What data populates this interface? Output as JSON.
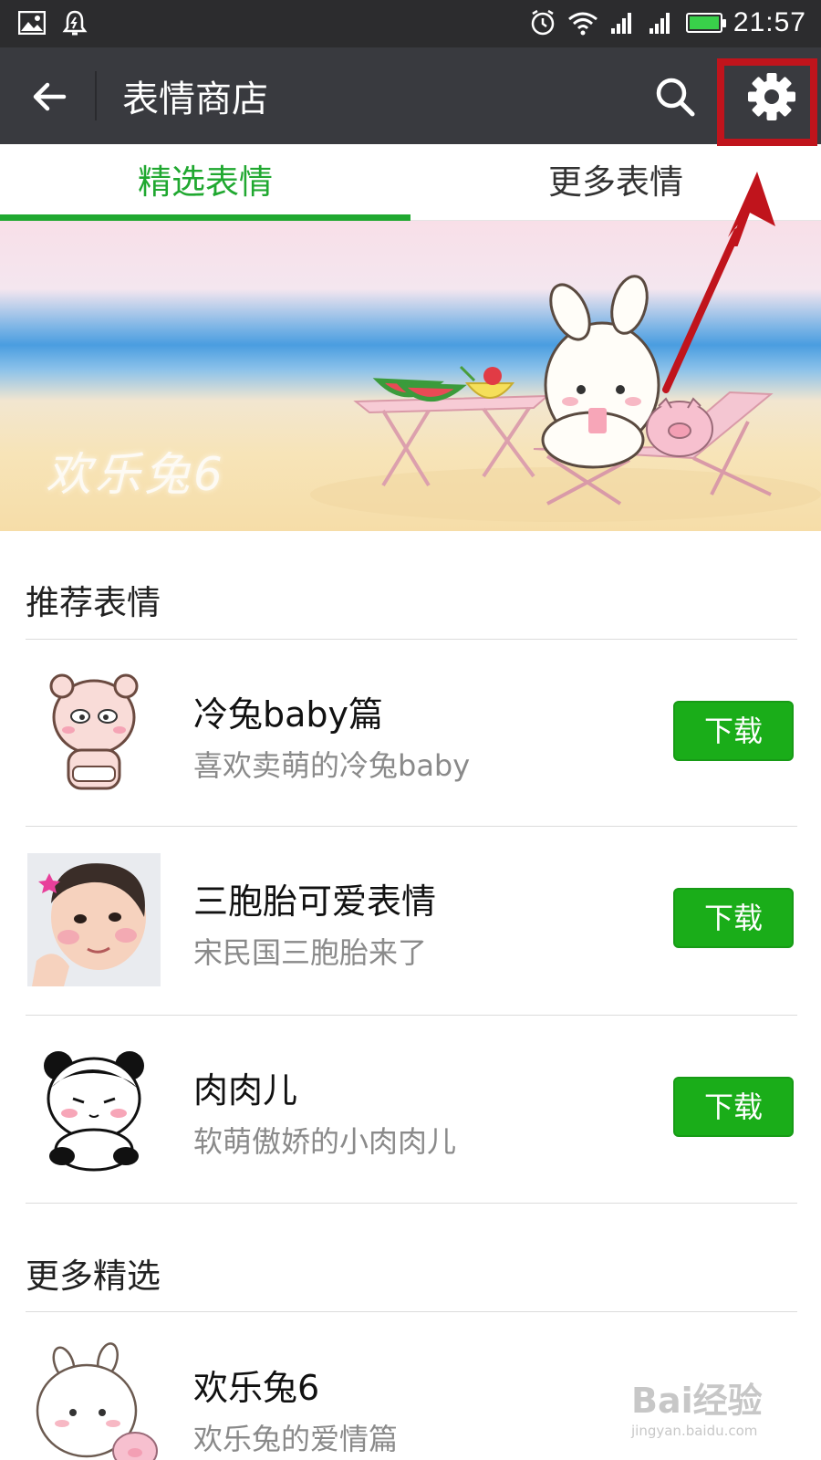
{
  "status_bar": {
    "time": "21:57",
    "icons": [
      "image-icon",
      "notification-bell-icon",
      "alarm-icon",
      "wifi-icon",
      "signal-icon",
      "signal-icon-2",
      "battery-icon"
    ]
  },
  "app_bar": {
    "title": "表情商店",
    "icons": {
      "back": "back-arrow-icon",
      "search": "search-icon",
      "settings": "gear-icon"
    }
  },
  "tabs": [
    {
      "label": "精选表情",
      "active": true
    },
    {
      "label": "更多表情",
      "active": false
    }
  ],
  "banner": {
    "title": "欢乐兔6"
  },
  "sections": [
    {
      "title": "推荐表情",
      "items": [
        {
          "name": "冷兔baby篇",
          "desc": "喜欢卖萌的冷兔baby",
          "button": "下载"
        },
        {
          "name": "三胞胎可爱表情",
          "desc": "宋民国三胞胎来了",
          "button": "下载"
        },
        {
          "name": "肉肉儿",
          "desc": "软萌傲娇的小肉肉儿",
          "button": "下载"
        }
      ]
    },
    {
      "title": "更多精选",
      "items": [
        {
          "name": "欢乐兔6",
          "desc": "欢乐兔的爱情篇"
        }
      ]
    }
  ],
  "watermark": {
    "text": "Bai经验",
    "sub": "jingyan.baidu.com"
  },
  "colors": {
    "accent": "#1aad19",
    "tab_active": "#20a830",
    "app_bar": "#393a3f",
    "status_bar": "#2c2c2e",
    "annotation": "#c0141c"
  }
}
